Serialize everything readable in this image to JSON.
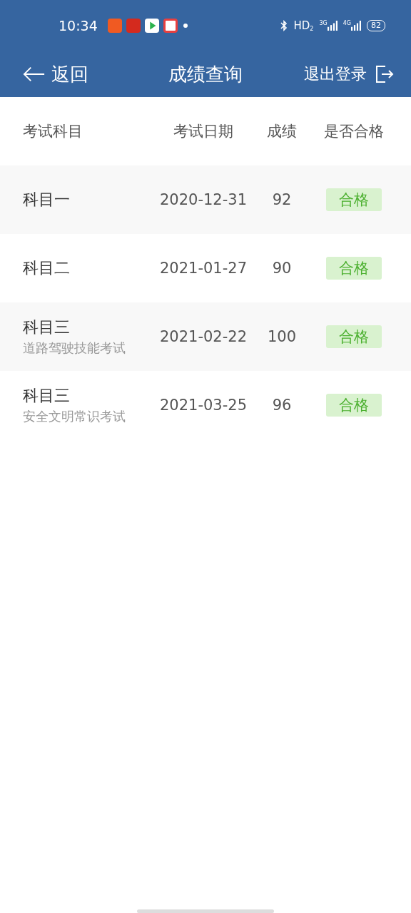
{
  "status_bar": {
    "time": "10:34",
    "hd": "HD",
    "hd_sub": "2",
    "signal_1": "3G",
    "signal_2": "4G",
    "battery": "82"
  },
  "nav": {
    "back": "返回",
    "title": "成绩查询",
    "logout": "退出登录"
  },
  "table": {
    "columns": [
      "考试科目",
      "考试日期",
      "成绩",
      "是否合格"
    ],
    "rows": [
      {
        "subject": "科目一",
        "date": "2020-12-31",
        "score": "92",
        "result": "合格",
        "passed": true
      },
      {
        "subject": "科目二",
        "date": "2021-01-27",
        "score": "90",
        "result": "合格",
        "passed": true
      },
      {
        "subject": "科目三",
        "detail": "道路驾驶技能考试",
        "date": "2021-02-22",
        "score": "100",
        "result": "合格",
        "passed": true
      },
      {
        "subject": "科目三",
        "detail": "安全文明常识考试",
        "date": "2021-03-25",
        "score": "96",
        "result": "合格",
        "passed": true
      }
    ]
  }
}
